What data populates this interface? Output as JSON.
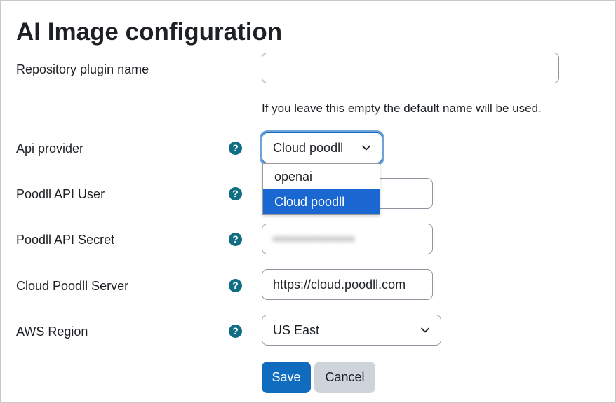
{
  "page": {
    "title": "AI Image configuration"
  },
  "form": {
    "repository_name": {
      "label": "Repository plugin name",
      "value": "",
      "hint": "If you leave this empty the default name will be used."
    },
    "api_provider": {
      "label": "Api provider",
      "selected": "Cloud poodll",
      "options": [
        "openai",
        "Cloud poodll"
      ]
    },
    "api_user": {
      "label": "Poodll API User",
      "value": ""
    },
    "api_secret": {
      "label": "Poodll API Secret",
      "value": "••••••••••••••••"
    },
    "server": {
      "label": "Cloud Poodll Server",
      "value": "https://cloud.poodll.com"
    },
    "aws_region": {
      "label": "AWS Region",
      "selected": "US East"
    },
    "help_glyph": "?"
  },
  "actions": {
    "save_label": "Save",
    "cancel_label": "Cancel"
  },
  "colors": {
    "primary": "#0f6cbf",
    "help_icon": "#0f6e83",
    "selected_option": "#1a67d2"
  },
  "icons": {
    "help": "question-circle-icon",
    "chevron": "chevron-down-icon"
  }
}
